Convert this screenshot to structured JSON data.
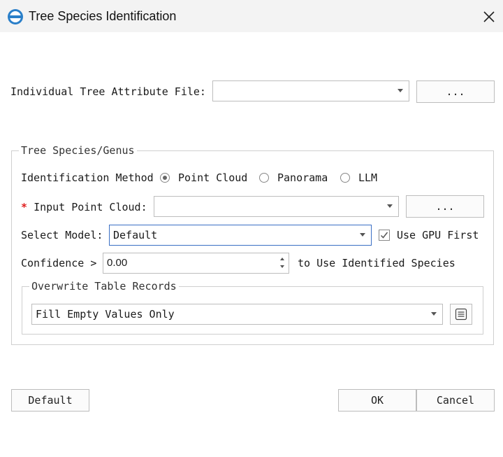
{
  "window": {
    "title": "Tree Species Identification",
    "logo_icon": "app-logo-icon",
    "close_icon": "close-icon"
  },
  "attribute_file": {
    "label": "Individual Tree Attribute File:",
    "value": "",
    "browse_label": "..."
  },
  "species_group": {
    "title": "Tree Species/Genus",
    "method": {
      "label": "Identification Method",
      "options": [
        {
          "label": "Point Cloud",
          "selected": true
        },
        {
          "label": "Panorama",
          "selected": false
        },
        {
          "label": "LLM",
          "selected": false
        }
      ]
    },
    "input_point_cloud": {
      "required_mark": "*",
      "label": "Input Point Cloud:",
      "value": "",
      "browse_label": "..."
    },
    "select_model": {
      "label": "Select Model:",
      "value": "Default",
      "use_gpu_label": "Use GPU First",
      "use_gpu_checked": true
    },
    "confidence": {
      "label": "Confidence >",
      "value": "0.00",
      "suffix": "to Use Identified Species"
    },
    "overwrite": {
      "title": "Overwrite Table Records",
      "value": "Fill Empty Values Only",
      "icon": "list-icon"
    }
  },
  "footer": {
    "default_label": "Default",
    "ok_label": "OK",
    "cancel_label": "Cancel"
  },
  "colors": {
    "required": "#e02020",
    "focus_border": "#3a6fc4",
    "titlebar": "#f3f3f3"
  }
}
